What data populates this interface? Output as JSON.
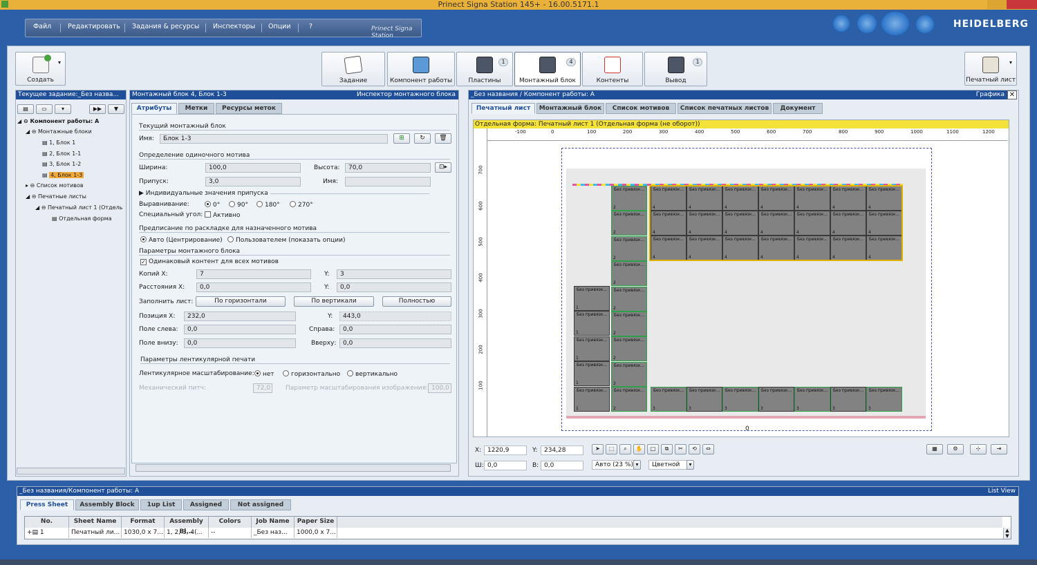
{
  "window": {
    "title": "Prinect Signa Station 145+  -  16.00.5171.1"
  },
  "menu": {
    "items": [
      "Файл",
      "Редактировать",
      "Задания & ресурсы",
      "Инспекторы",
      "Опции",
      "?"
    ],
    "brand": "Prinect Signa Station"
  },
  "logo": "HEIDELBERG",
  "toolbar": {
    "create": "Создать",
    "flow": [
      {
        "label": "Задание",
        "badge": ""
      },
      {
        "label": "Компонент работы",
        "badge": ""
      },
      {
        "label": "Пластины",
        "badge": "1"
      },
      {
        "label": "Монтажный блок",
        "badge": "4"
      },
      {
        "label": "Контенты",
        "badge": ""
      },
      {
        "label": "Вывод",
        "badge": "1"
      }
    ],
    "print_sheet": "Печатный лист"
  },
  "left_panel": {
    "header": "Текущее задание:_Без назва...",
    "tree": [
      {
        "label": "Компонент работы: A",
        "level": 0,
        "bold": true
      },
      {
        "label": "Монтажные блоки",
        "level": 1
      },
      {
        "label": "1, Блок 1",
        "level": 2
      },
      {
        "label": "2, Блок 1-1",
        "level": 2
      },
      {
        "label": "3, Блок 1-2",
        "level": 2
      },
      {
        "label": "4, Блок 1-3",
        "level": 2,
        "selected": true
      },
      {
        "label": "Список мотивов",
        "level": 1
      },
      {
        "label": "Печатные листы",
        "level": 1
      },
      {
        "label": "Печатный лист 1 (Отдель",
        "level": 2
      },
      {
        "label": "Отдельная форма",
        "level": 3
      }
    ]
  },
  "inspector": {
    "header_left": "Монтажный блок 4, Блок 1-3",
    "header_right": "Инспектор монтажного блока",
    "tabs": [
      "Атрибуты",
      "Метки",
      "Ресурсы меток"
    ],
    "current_block_title": "Текущий монтажный блок",
    "name_label": "Имя:",
    "name_value": "Блок 1-3",
    "single_motif_title": "Определение одиночного мотива",
    "width_label": "Ширина:",
    "width_value": "100,0",
    "height_label": "Высота:",
    "height_value": "70,0",
    "bleed_label": "Припуск:",
    "bleed_value": "3,0",
    "name2_label": "Имя:",
    "name2_value": "",
    "individual_bleed": "Индивидуальные значения припуска",
    "align_label": "Выравнивание:",
    "align_options": [
      "0°",
      "90°",
      "180°",
      "270°"
    ],
    "special_angle_label": "Специальный угол:",
    "special_angle_check": "Активно",
    "layout_rule_title": "Предписание по раскладке для назначенного мотива",
    "layout_rule_options": [
      "Авто (Центрирование)",
      "Пользователем (показать опции)"
    ],
    "block_params_title": "Параметры монтажного блока",
    "same_content": "Одинаковый контент для всех мотивов",
    "copies_x_label": "Копий X:",
    "copies_x": "7",
    "copies_y_label": "Y:",
    "copies_y": "3",
    "dist_x_label": "Расстояния X:",
    "dist_x": "0,0",
    "dist_y_label": "Y:",
    "dist_y": "0,0",
    "fill_label": "Заполнить лист:",
    "fill_buttons": [
      "По горизонтали",
      "По вертикали",
      "Полностью"
    ],
    "pos_x_label": "Позиция X:",
    "pos_x": "232,0",
    "pos_y_label": "Y:",
    "pos_y": "443,0",
    "margin_left_label": "Поле слева:",
    "margin_left": "0,0",
    "margin_right_label": "Справа:",
    "margin_right": "0,0",
    "margin_bottom_label": "Поле внизу:",
    "margin_bottom": "0,0",
    "margin_top_label": "Вверху:",
    "margin_top": "0,0",
    "lenticular_title": "Параметры лентикулярной печати",
    "lenticular_label": "Лентикулярное масштабирование:",
    "lenticular_options": [
      "нет",
      "горизонтально",
      "вертикально"
    ],
    "mech_pitch_label": "Механический питч:",
    "mech_pitch": "72,0",
    "scale_param_label": "Параметр масштабирования изображения:",
    "scale_param": "100,0"
  },
  "graphic": {
    "header_left": "_Без названия / Компонент работы: A",
    "header_right": "Графика",
    "tabs": [
      "Печатный лист",
      "Монтажный блок",
      "Список мотивов",
      "Список печатных листов",
      "Документ"
    ],
    "banner": "Отдельная форма:  Печатный лист 1 (Отдельная форма (не оборот))",
    "ruler_h": [
      "-100",
      "0",
      "100",
      "200",
      "300",
      "400",
      "500",
      "600",
      "700",
      "800",
      "900",
      "1000",
      "1100",
      "1200"
    ],
    "ruler_v": [
      "700",
      "600",
      "500",
      "400",
      "300",
      "200",
      "100"
    ],
    "tile_label": "Без привязк...",
    "x_label": "X:",
    "x_value": "1220,9",
    "y_label": "Y:",
    "y_value": "234,28",
    "w_label": "Ш:",
    "w_value": "0,0",
    "h_label": "В:",
    "h_value": "0,0",
    "zoom": "Авто (23 %)",
    "color_mode": "Цветной",
    "bottom_zero": "0"
  },
  "list_view": {
    "header_left": "_Без названия/Компонент работы: A",
    "header_right": "List View",
    "tabs": [
      "Press Sheet",
      "Assembly Block",
      "1up List",
      "Assigned",
      "Not assigned"
    ],
    "columns": [
      "No.",
      "Sheet Name",
      "Format",
      "Assembly Bl...",
      "Colors",
      "Job Name",
      "Paper Size"
    ],
    "rows": [
      [
        "1",
        "Печатный ли...",
        "1030,0 x 7...",
        "1, 2, 3, 4(...",
        "--",
        "_Без наз...",
        "1000,0 x 7..."
      ]
    ]
  },
  "colors": {
    "accent": "#1f4f99",
    "frame": "#2b5fa8",
    "selection": "#f2a93b",
    "highlight_block": "#e0b400"
  }
}
